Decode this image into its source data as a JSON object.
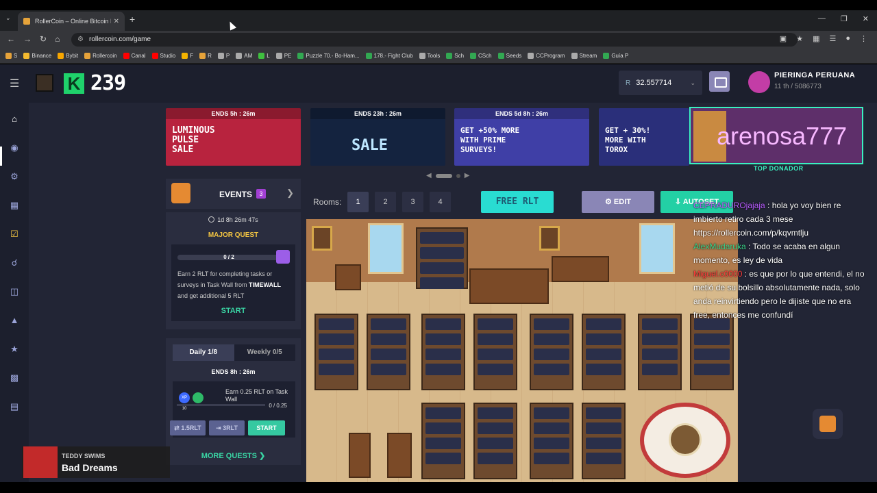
{
  "browser": {
    "tab_title": "RollerCoin – Online Bitcoin Mi",
    "url": "rollercoin.com/game",
    "bookmarks": [
      "S",
      "Binance",
      "Bybit",
      "Rollercoin",
      "Canal",
      "Studio",
      "F",
      "R",
      "P",
      "AM",
      "L",
      "PE",
      "Puzzle 70.- Bo-Ham...",
      "178.- Fight Club",
      "Tools",
      "Sch",
      "CSch",
      "Seeds",
      "CCProgram",
      "Stream",
      "Guía P"
    ],
    "bookmark_colors": [
      "#e6a33a",
      "#f3ba2f",
      "#f7a600",
      "#e6a33a",
      "#ff0000",
      "#ff0000",
      "#f4b400",
      "#e6a33a",
      "#aaaaaa",
      "#aaaaaa",
      "#3fbf3f",
      "#aaaaaa",
      "#32a852",
      "#32a852",
      "#aaaaaa",
      "#32a852",
      "#32a852",
      "#32a852",
      "#aaaaaa",
      "#aaaaaa",
      "#32a852"
    ]
  },
  "header": {
    "level": "239",
    "balance": "32.557714",
    "currency_symbol": "R",
    "user_name": "PIERINGA PERUANA",
    "user_rank": "11 th / 5086773"
  },
  "banners": [
    {
      "ends": "ENDS  5h : 26m",
      "text": "LUMINOUS\nPULSE\nSALE",
      "color": "#b8233e"
    },
    {
      "ends": "ENDS  23h : 26m",
      "text": "SALE",
      "color": "#14233f"
    },
    {
      "ends": "ENDS  5d 8h : 26m",
      "text": "GET +50% MORE\nWITH PRIME\nSURVEYS!",
      "color": "#3f3fa6"
    },
    {
      "ends": "",
      "text": "GET + 30%!\nMORE WITH\nTOROX",
      "color": "#2a2f7a"
    }
  ],
  "events": {
    "label": "EVENTS",
    "count": "3",
    "timer": "1d 8h 26m 47s",
    "major_quest": "MAJOR QUEST",
    "progress_text": "0 / 2",
    "progress": 0,
    "desc_prefix": "Earn 2 RLT for completing tasks or surveys in Task Wall from ",
    "desc_bold": "TIMEWALL",
    "desc_suffix": " and get additional 5 RLT",
    "start": "START"
  },
  "daily": {
    "tab_daily": "Daily  1/8",
    "tab_weekly": "Weekly  0/5",
    "ends": "ENDS    8h : 26m",
    "xp_badge": "XP 10",
    "task_title": "Earn 0.25 RLT on Task Wall",
    "progress_text": "0 / 0.25",
    "progress": 0,
    "btn1": "⇄ 1.5RLT",
    "btn2": "⇥ 3RLT",
    "start": "START",
    "more": "MORE QUESTS"
  },
  "rooms": {
    "label": "Rooms:",
    "numbers": [
      "1",
      "2",
      "3",
      "4"
    ],
    "free_rlt": "FREE RLT",
    "edit": "EDIT",
    "autoset": "AUTOSET"
  },
  "chat": {
    "streamer": "arenosa777",
    "donor": "TOP DONADOR",
    "messages": [
      {
        "user": "CEPRADUROjajaja",
        "text": ": hola yo voy bien re imbierto retiro cada 3 mese https://rollercoin.com/p/kqvmtlju"
      },
      {
        "user": "AlexMudaruka",
        "text": ": Todo se acaba en algun momento, es ley de vida"
      },
      {
        "user": "Miguel.c0000",
        "text": ": es que por lo que entendi, el no metió de su bolsillo absolutamente nada, solo anda reinvirtiendo pero le dijiste que no era free, entonces me confundí"
      }
    ]
  },
  "music": {
    "artist": "TEDDY SWIMS",
    "song": "Bad Dreams"
  }
}
